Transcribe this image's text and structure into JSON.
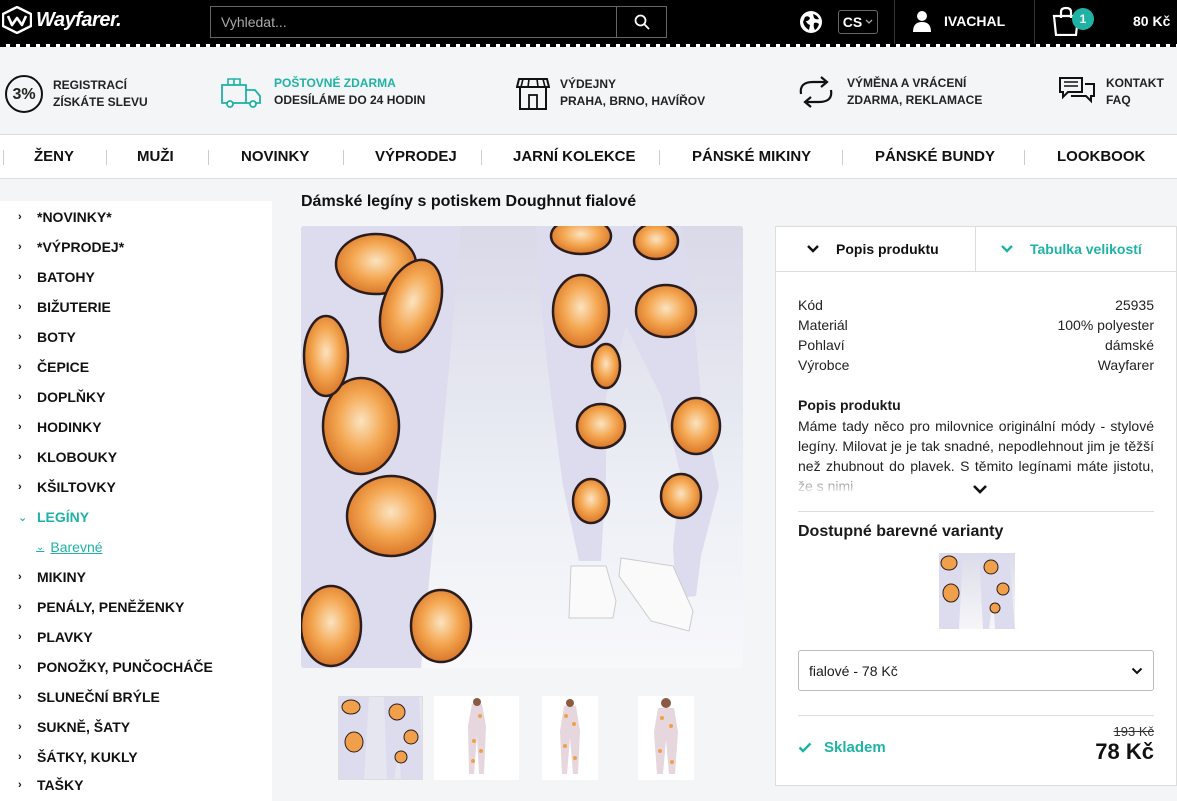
{
  "header": {
    "logo_text": "Wayfarer.",
    "search_placeholder": "Vyhledat...",
    "language": "CS",
    "user_name": "IVACHAL",
    "cart_count": "1",
    "cart_total": "80 Kč"
  },
  "benefits": [
    {
      "badge": "3%",
      "line1": "REGISTRACÍ",
      "line2": "ZÍSKÁTE SLEVU"
    },
    {
      "line1": "POŠTOVNÉ ZDARMA",
      "line2": "ODESÍLÁME DO 24 HODIN"
    },
    {
      "line1": "VÝDEJNY",
      "line2": "PRAHA, BRNO, HAVÍŘOV"
    },
    {
      "line1": "VÝMĚNA A VRÁCENÍ",
      "line2": "ZDARMA, REKLAMACE"
    },
    {
      "line1": "KONTAKT",
      "line2": "FAQ"
    }
  ],
  "nav": [
    "ŽENY",
    "MUŽI",
    "NOVINKY",
    "VÝPRODEJ",
    "JARNÍ KOLEKCE",
    "PÁNSKÉ MIKINY",
    "PÁNSKÉ BUNDY",
    "LOOKBOOK"
  ],
  "sidebar": {
    "categories": [
      "*NOVINKY*",
      "*VÝPRODEJ*",
      "BATOHY",
      "BIŽUTERIE",
      "BOTY",
      "ČEPICE",
      "DOPLŇKY",
      "HODINKY",
      "KLOBOUKY",
      "KŠILTOVKY",
      "LEGÍNY",
      "MIKINY",
      "PENÁLY, PENĚŽENKY",
      "PLAVKY",
      "PONOŽKY, PUNČOCHÁČE",
      "SLUNEČNÍ BRÝLE",
      "SUKNĚ, ŠATY",
      "ŠÁTKY, KUKLY",
      "TAŠKY"
    ],
    "active": "LEGÍNY",
    "subcategory": "Barevné"
  },
  "product": {
    "title": "Dámské legíny s potiskem Doughnut fialové",
    "tabs": [
      "Popis produktu",
      "Tabulka velikostí"
    ],
    "specs": [
      {
        "label": "Kód",
        "value": "25935"
      },
      {
        "label": "Materiál",
        "value": "100% polyester"
      },
      {
        "label": "Pohlaví",
        "value": "dámské"
      },
      {
        "label": "Výrobce",
        "value": "Wayfarer"
      }
    ],
    "description_title": "Popis produktu",
    "description": "Máme tady něco pro milovnice originální módy - stylové legíny. Milovat je je tak snadné, nepodlehnout jim je těžší než zhubnout do plavek. S těmito legínami máte jistotu, že s nimi",
    "variants_title": "Dostupné barevné varianty",
    "selected_variant": "fialové - 78 Kč",
    "stock": "Skladem",
    "old_price": "193 Kč",
    "price": "78 Kč"
  },
  "colors": {
    "accent": "#1fb3a5",
    "topbar": "#000000",
    "legging_base": "#dcdcee",
    "donut": "#f0a04b"
  }
}
